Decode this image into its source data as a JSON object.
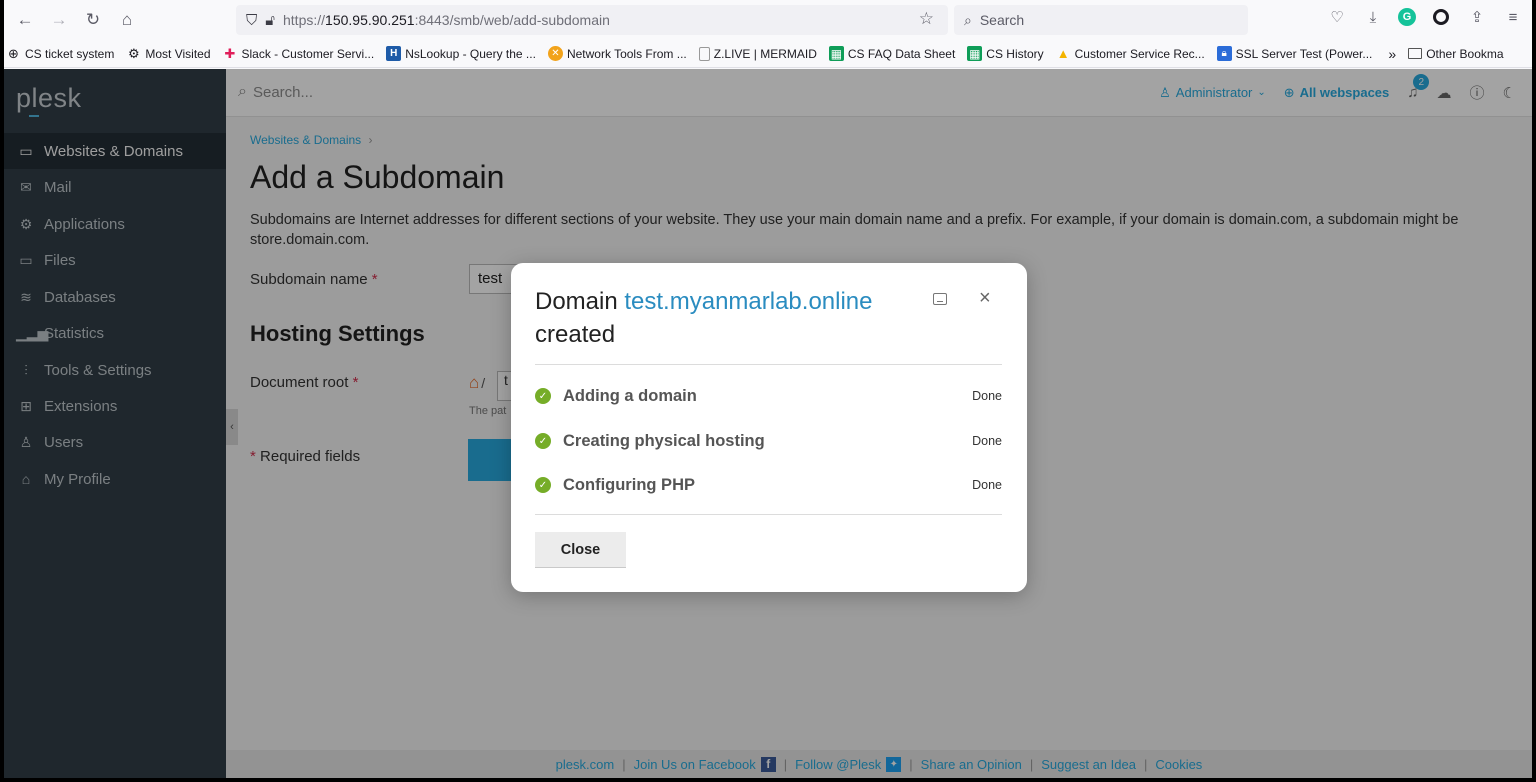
{
  "browser": {
    "url_prefix": "https://",
    "url_host": "150.95.90.251",
    "url_rest": ":8443/smb/web/add-subdomain",
    "search_placeholder": "Search",
    "bookmarks": [
      {
        "label": "CS ticket system",
        "icon": "globe-icon"
      },
      {
        "label": "Most Visited",
        "icon": "gear-icon"
      },
      {
        "label": "Slack - Customer Servi...",
        "icon": "slack-icon"
      },
      {
        "label": "NsLookup - Query the ...",
        "icon": "nslookup-icon"
      },
      {
        "label": "Network Tools From ...",
        "icon": "network-tools-icon"
      },
      {
        "label": "Z.LIVE | MERMAID",
        "icon": "page-icon"
      },
      {
        "label": "CS FAQ Data Sheet",
        "icon": "sheets-icon"
      },
      {
        "label": "CS History",
        "icon": "sheets-icon"
      },
      {
        "label": "Customer Service Rec...",
        "icon": "drive-icon"
      },
      {
        "label": "SSL Server Test (Power...",
        "icon": "lock-icon"
      }
    ],
    "other_bookmarks": "Other Bookma"
  },
  "sidebar": {
    "logo": "plesk",
    "items": [
      {
        "label": "Websites & Domains",
        "icon": "monitor-icon"
      },
      {
        "label": "Mail",
        "icon": "mail-icon"
      },
      {
        "label": "Applications",
        "icon": "gear-icon"
      },
      {
        "label": "Files",
        "icon": "folder-icon"
      },
      {
        "label": "Databases",
        "icon": "database-icon"
      },
      {
        "label": "Statistics",
        "icon": "chart-icon"
      },
      {
        "label": "Tools & Settings",
        "icon": "sliders-icon"
      },
      {
        "label": "Extensions",
        "icon": "extensions-icon"
      },
      {
        "label": "Users",
        "icon": "user-icon"
      },
      {
        "label": "My Profile",
        "icon": "profile-icon"
      }
    ]
  },
  "header": {
    "search_placeholder": "Search...",
    "admin": "Administrator",
    "webspaces": "All webspaces",
    "notification_count": "2"
  },
  "page": {
    "breadcrumb": "Websites & Domains",
    "title": "Add a Subdomain",
    "description": "Subdomains are Internet addresses for different sections of your website. They use your main domain name and a prefix. For example, if your domain is domain.com, a subdomain might be store.domain.com.",
    "subdomain_label": "Subdomain name",
    "subdomain_value": "test",
    "hosting_title": "Hosting Settings",
    "docroot_label": "Document root",
    "docroot_hint": "The pat",
    "docroot_value": "t",
    "required_note": "Required fields",
    "required_mark": "*"
  },
  "dialog": {
    "title_prefix": "Domain ",
    "domain": "test.myanmarlab.online",
    "title_suffix": "created",
    "steps": [
      {
        "label": "Adding a domain",
        "status": "Done"
      },
      {
        "label": "Creating physical hosting",
        "status": "Done"
      },
      {
        "label": "Configuring PHP",
        "status": "Done"
      }
    ],
    "close_label": "Close"
  },
  "footer": {
    "links": [
      "plesk.com",
      "Join Us on Facebook",
      "Follow @Plesk",
      "Share an Opinion",
      "Suggest an Idea",
      "Cookies"
    ]
  },
  "colors": {
    "accent": "#28aade",
    "sidebar_bg": "#334049",
    "success": "#76ad28"
  }
}
